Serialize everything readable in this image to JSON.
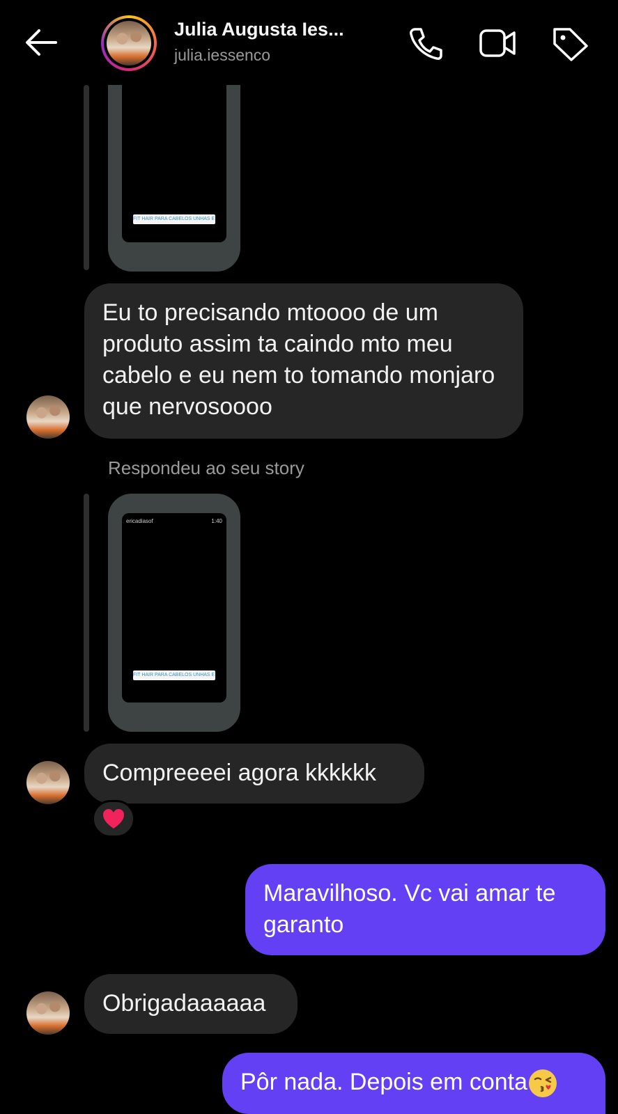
{
  "header": {
    "contact_name": "Julia Augusta Ies...",
    "username": "julia.iessenco",
    "icons": [
      "back-arrow-icon",
      "phone-icon",
      "video-camera-icon",
      "tag-icon"
    ]
  },
  "stories": [
    {
      "username": "",
      "time": "",
      "link_text": "FIT HAIR PARA CABELOS UNHAS E PELE"
    },
    {
      "username": "ericadiasof",
      "time": "1:40",
      "link_text": "FIT HAIR PARA CABELOS UNHAS E PELE"
    }
  ],
  "reply_label": "Respondeu ao seu story",
  "messages": [
    {
      "direction": "in",
      "text": "Eu to precisando mtoooo de um produto assim ta caindo mto meu cabelo e eu nem to tomando monjaro que nervosoooo"
    },
    {
      "direction": "in",
      "text": "Compreeeei agora kkkkkk",
      "reaction": "heart"
    },
    {
      "direction": "out",
      "text": "Maravilhoso. Vc vai amar te garanto"
    },
    {
      "direction": "in",
      "text": "Obrigadaaaaaa"
    },
    {
      "direction": "out",
      "text": "Pôr nada. Depois em conta",
      "trailing_emoji": "kissing-face-emoji"
    }
  ],
  "colors": {
    "background": "#000000",
    "incoming_bubble": "#262626",
    "outgoing_bubble": "#6440f5",
    "heart": "#f0245a"
  }
}
